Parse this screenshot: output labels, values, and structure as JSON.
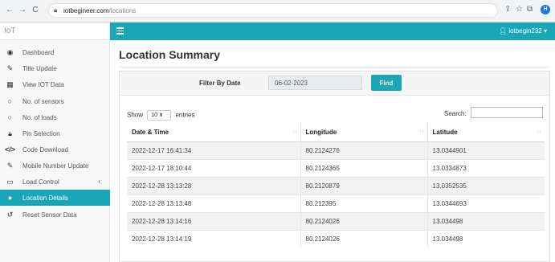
{
  "browser": {
    "url_domain": "iotbegineer.com",
    "url_path": "/locations"
  },
  "app": {
    "brand": "IoT",
    "user": "iotbegin232"
  },
  "sidebar": {
    "items": [
      {
        "label": "Dashboard",
        "icon": "dashboard-icon"
      },
      {
        "label": "Title Update",
        "icon": "edit-icon"
      },
      {
        "label": "View IOT Data",
        "icon": "table-icon"
      },
      {
        "label": "No. of sensors",
        "icon": "circle-icon"
      },
      {
        "label": "No. of loads",
        "icon": "circle-icon"
      },
      {
        "label": "Pin Selection",
        "icon": "lock-icon"
      },
      {
        "label": "Code Download",
        "icon": "code-icon"
      },
      {
        "label": "Mobile Number Update",
        "icon": "edit-icon"
      },
      {
        "label": "Load Control",
        "icon": "window-icon"
      },
      {
        "label": "Location Details",
        "icon": "map-marker-icon"
      },
      {
        "label": "Reset Sensor Data",
        "icon": "reset-icon"
      }
    ],
    "active_index": 9
  },
  "main": {
    "title": "Location Summary",
    "filter": {
      "label": "Filter By Date",
      "date_value": "06-02-2023",
      "button": "Find"
    },
    "show": {
      "prefix": "Show",
      "value": "10",
      "suffix": "entries"
    },
    "search_label": "Search:",
    "table": {
      "columns": [
        "Date & Time",
        "Longitude",
        "Latitude"
      ],
      "rows": [
        [
          "2022-12-17 16:41:34",
          "80.2124276",
          "13.0344901"
        ],
        [
          "2022-12-17 18:10:44",
          "80.2124365",
          "13.0334873"
        ],
        [
          "2022-12-28 13:13:28",
          "80.2120879",
          "13.0352535"
        ],
        [
          "2022-12-28 13:13:48",
          "80.212395",
          "13.0344693"
        ],
        [
          "2022-12-28 13:14:16",
          "80.2124026",
          "13.034498"
        ],
        [
          "2022-12-28 13:14:19",
          "80.2124026",
          "13.034498"
        ]
      ]
    }
  },
  "colors": {
    "accent": "#1aa6b7"
  }
}
